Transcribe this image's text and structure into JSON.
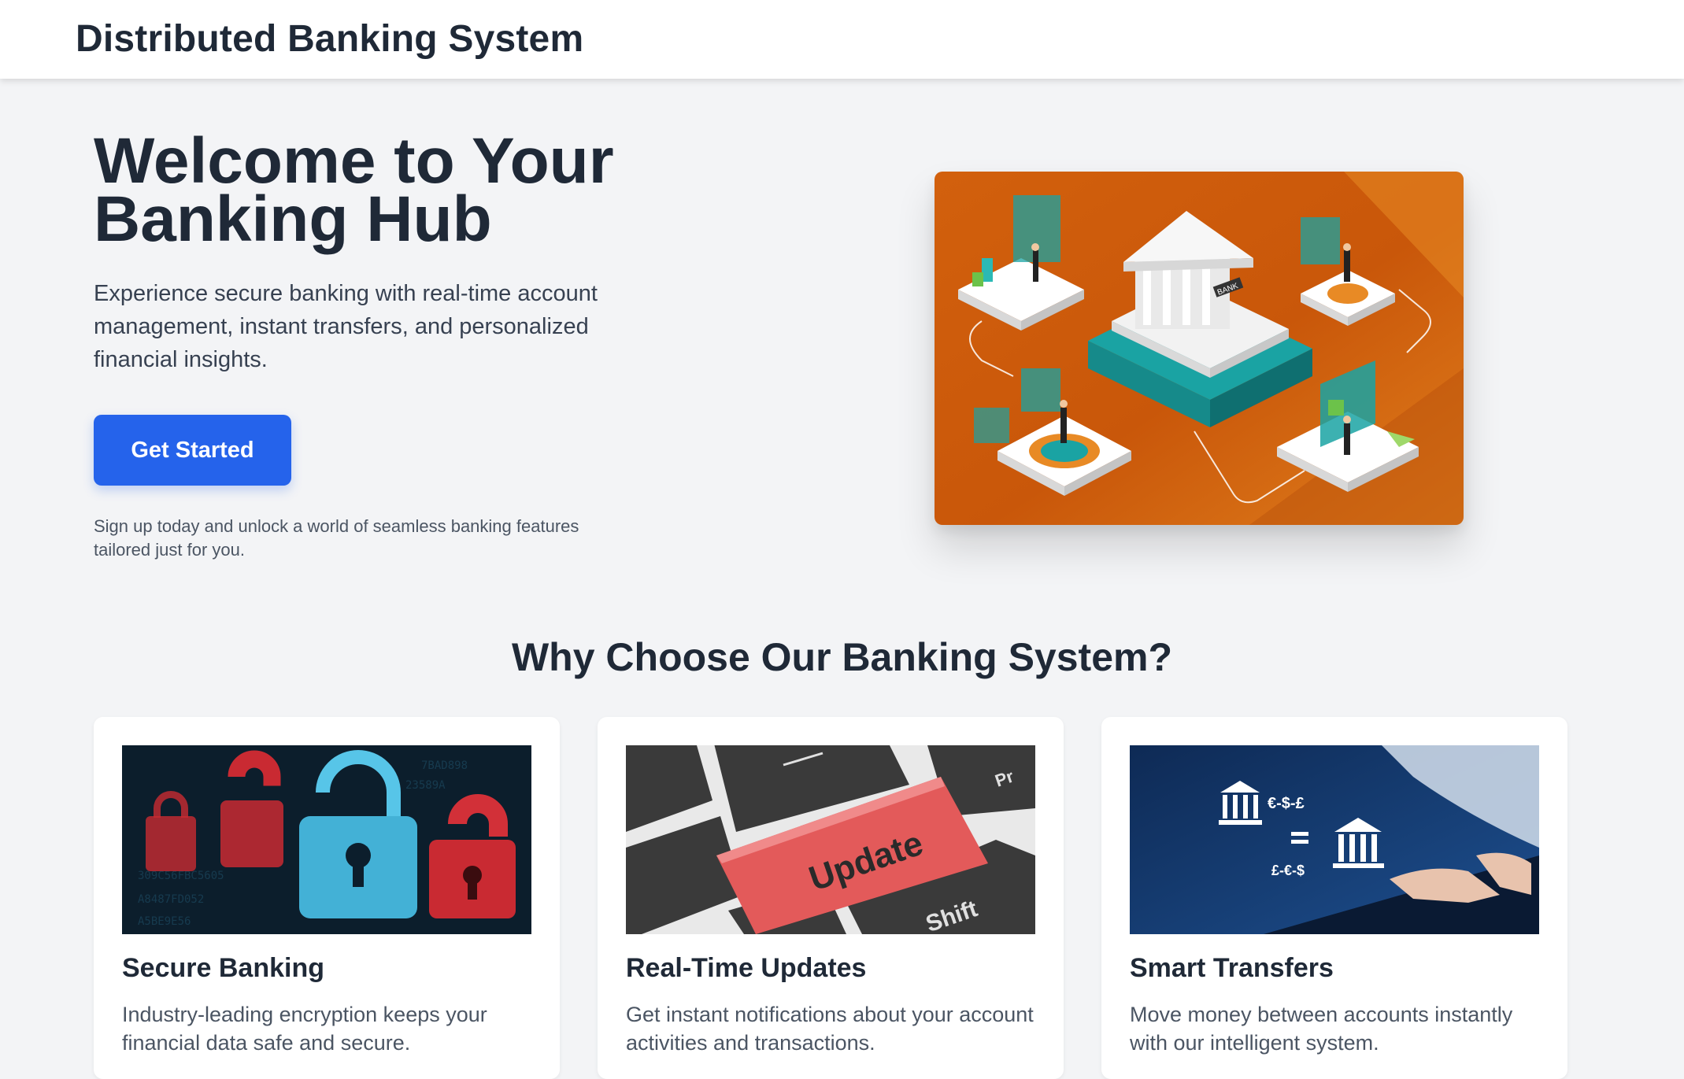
{
  "header": {
    "brand": "Distributed Banking System"
  },
  "hero": {
    "title_line1": "Welcome to Your",
    "title_line2": "Banking Hub",
    "description": "Experience secure banking with real-time account management, instant transfers, and personalized financial insights.",
    "cta_label": "Get Started",
    "cta_note": "Sign up today and unlock a world of seamless banking features tailored just for you.",
    "illustration_bank_sign": "BANK"
  },
  "features": {
    "title": "Why Choose Our Banking System?",
    "cards": [
      {
        "title": "Secure Banking",
        "description": "Industry-leading encryption keeps your financial data safe and secure.",
        "image": "padlock-image"
      },
      {
        "title": "Real-Time Updates",
        "description": "Get instant notifications about your account activities and transactions.",
        "image": "update-key-image",
        "image_text": {
          "update": "Update",
          "shift": "Shift",
          "pr": "Pr"
        }
      },
      {
        "title": "Smart Transfers",
        "description": "Move money between accounts instantly with our intelligent system.",
        "image": "transfer-image",
        "image_text": {
          "top": "€-$-£",
          "bottom": "£-€-$"
        }
      }
    ]
  },
  "colors": {
    "primary": "#2563eb",
    "text_dark": "#1f2937",
    "background": "#f3f4f6",
    "illustration_orange": "#d9640f",
    "illustration_teal": "#1aa3a3"
  }
}
